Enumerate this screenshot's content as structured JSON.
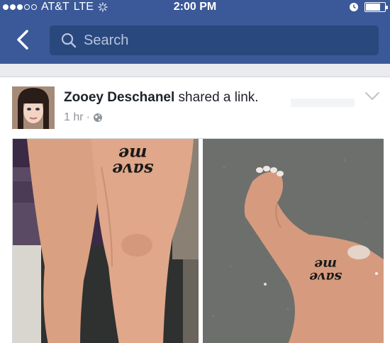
{
  "status_bar": {
    "carrier": "AT&T",
    "network": "LTE",
    "time": "2:00 PM",
    "battery_level": 0.8
  },
  "nav": {
    "search_placeholder": "Search"
  },
  "post": {
    "author": "Zooey Deschanel",
    "action": " shared a link.",
    "time_ago": "1 hr",
    "separator": "·",
    "tattoo_text_top": "me",
    "tattoo_text_bottom": "save"
  },
  "colors": {
    "brand": "#3b5998",
    "search_bg": "#29487d",
    "meta_gray": "#90949c"
  }
}
